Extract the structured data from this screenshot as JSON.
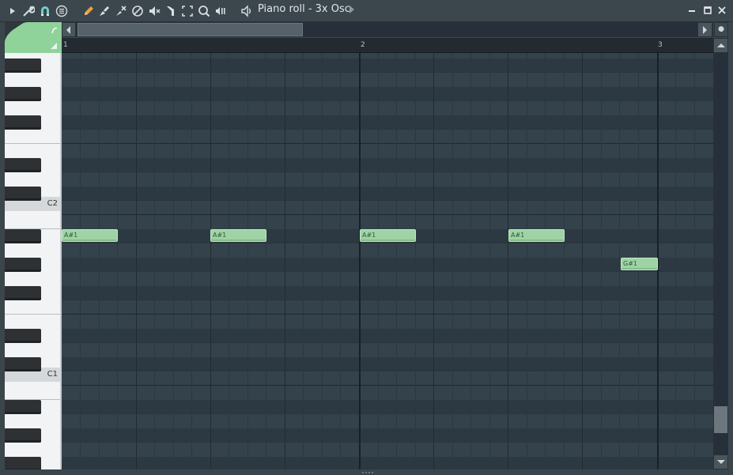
{
  "window": {
    "title": "Piano roll - 3x Osc",
    "controls": [
      "minimize-icon",
      "maximize-icon",
      "close-icon"
    ]
  },
  "toolbar": {
    "icons": [
      "menu-arrow-icon",
      "wrench-icon",
      "magnet-icon",
      "pattern-menu-icon",
      "pencil-icon",
      "paint-brush-icon",
      "delete-icon",
      "mute-icon",
      "slice-icon",
      "select-icon",
      "zoom-icon",
      "playback-icon",
      "speaker-icon"
    ],
    "accent": "#f0a040"
  },
  "timeline": {
    "bars": [
      "1",
      "2",
      "3"
    ]
  },
  "keyboard": {
    "labels": [
      "C2",
      "C1"
    ]
  },
  "notes": [
    {
      "name": "A#1"
    },
    {
      "name": "A#1"
    },
    {
      "name": "A#1"
    },
    {
      "name": "A#1"
    },
    {
      "name": "G#1"
    }
  ],
  "colors": {
    "note_fill": "#9fd3a5",
    "grid_bg": "#34424b",
    "tool_tab": "#8fd29a"
  }
}
